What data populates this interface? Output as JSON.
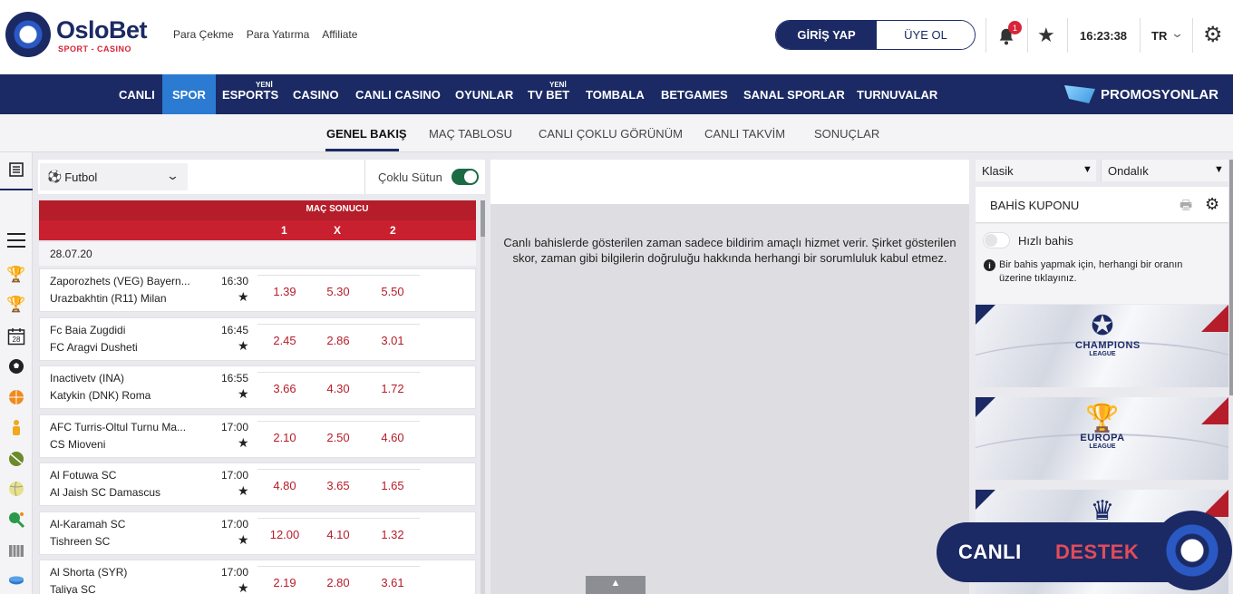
{
  "brand": {
    "name": "OsloBet",
    "tagline": "SPORT - CASINO"
  },
  "top_links": [
    "Para Çekme",
    "Para Yatırma",
    "Affiliate"
  ],
  "auth": {
    "login": "GİRİŞ YAP",
    "register": "ÜYE OL"
  },
  "notifications": {
    "count": "1"
  },
  "clock": "16:23:38",
  "language": "TR",
  "main_nav": {
    "items": [
      {
        "label": "CANLI"
      },
      {
        "label": "SPOR"
      },
      {
        "label": "ESPORTS",
        "badge": "YENİ"
      },
      {
        "label": "CASINO"
      },
      {
        "label": "CANLI CASINO"
      },
      {
        "label": "OYUNLAR"
      },
      {
        "label": "TV BET",
        "badge": "YENİ"
      },
      {
        "label": "TOMBALA"
      },
      {
        "label": "BETGAMES"
      },
      {
        "label": "SANAL SPORLAR"
      },
      {
        "label": "TURNUVALAR"
      }
    ],
    "promo": "PROMOSYONLAR"
  },
  "sub_nav": [
    "GENEL BAKIŞ",
    "MAÇ TABLOSU",
    "CANLI ÇOKLU GÖRÜNÜM",
    "CANLI TAKVİM",
    "SONUÇLAR"
  ],
  "rail": {
    "calendar_day": "28"
  },
  "sport_filter": {
    "selected": "Futbol",
    "multi_column_label": "Çoklu Sütun"
  },
  "market": {
    "title": "MAÇ SONUCU",
    "cols": [
      "1",
      "X",
      "2"
    ]
  },
  "date_header": "28.07.20",
  "matches": [
    {
      "home": "Zaporozhets (VEG) Bayern...",
      "away": "Urazbakhtin (R11) Milan",
      "time": "16:30",
      "odds": [
        "1.39",
        "5.30",
        "5.50"
      ]
    },
    {
      "home": "Fc Baia Zugdidi",
      "away": "FC Aragvi Dusheti",
      "time": "16:45",
      "odds": [
        "2.45",
        "2.86",
        "3.01"
      ]
    },
    {
      "home": "Inactivetv (INA)",
      "away": "Katykin (DNK) Roma",
      "time": "16:55",
      "odds": [
        "3.66",
        "4.30",
        "1.72"
      ]
    },
    {
      "home": "AFC Turris-Oltul Turnu Ma...",
      "away": "CS Mioveni",
      "time": "17:00",
      "odds": [
        "2.10",
        "2.50",
        "4.60"
      ]
    },
    {
      "home": "Al Fotuwa SC",
      "away": "Al Jaish SC Damascus",
      "time": "17:00",
      "odds": [
        "4.80",
        "3.65",
        "1.65"
      ]
    },
    {
      "home": "Al-Karamah SC",
      "away": "Tishreen SC",
      "time": "17:00",
      "odds": [
        "12.00",
        "4.10",
        "1.32"
      ]
    },
    {
      "home": "Al Shorta (SYR)",
      "away": "Taliya SC",
      "time": "17:00",
      "odds": [
        "2.19",
        "2.80",
        "3.61"
      ]
    }
  ],
  "notice": "Canlı bahislerde gösterilen zaman sadece bildirim amaçlı hizmet verir. Şirket gösterilen skor, zaman gibi bilgilerin doğruluğu hakkında herhangi bir sorumluluk kabul etmez.",
  "betslip": {
    "odds_type": "Klasik",
    "odds_format": "Ondalık",
    "title": "BAHİS KUPONU",
    "quick_bet": "Hızlı bahis",
    "info": "Bir bahis yapmak için, herhangi bir oranın üzerine tıklayınız."
  },
  "banners": [
    {
      "line1": "CHAMPIONS",
      "line2": "LEAGUE"
    },
    {
      "line1": "EUROPA",
      "line2": "LEAGUE"
    }
  ],
  "live_support": {
    "word1": "CANLI",
    "word2": "DESTEK"
  }
}
